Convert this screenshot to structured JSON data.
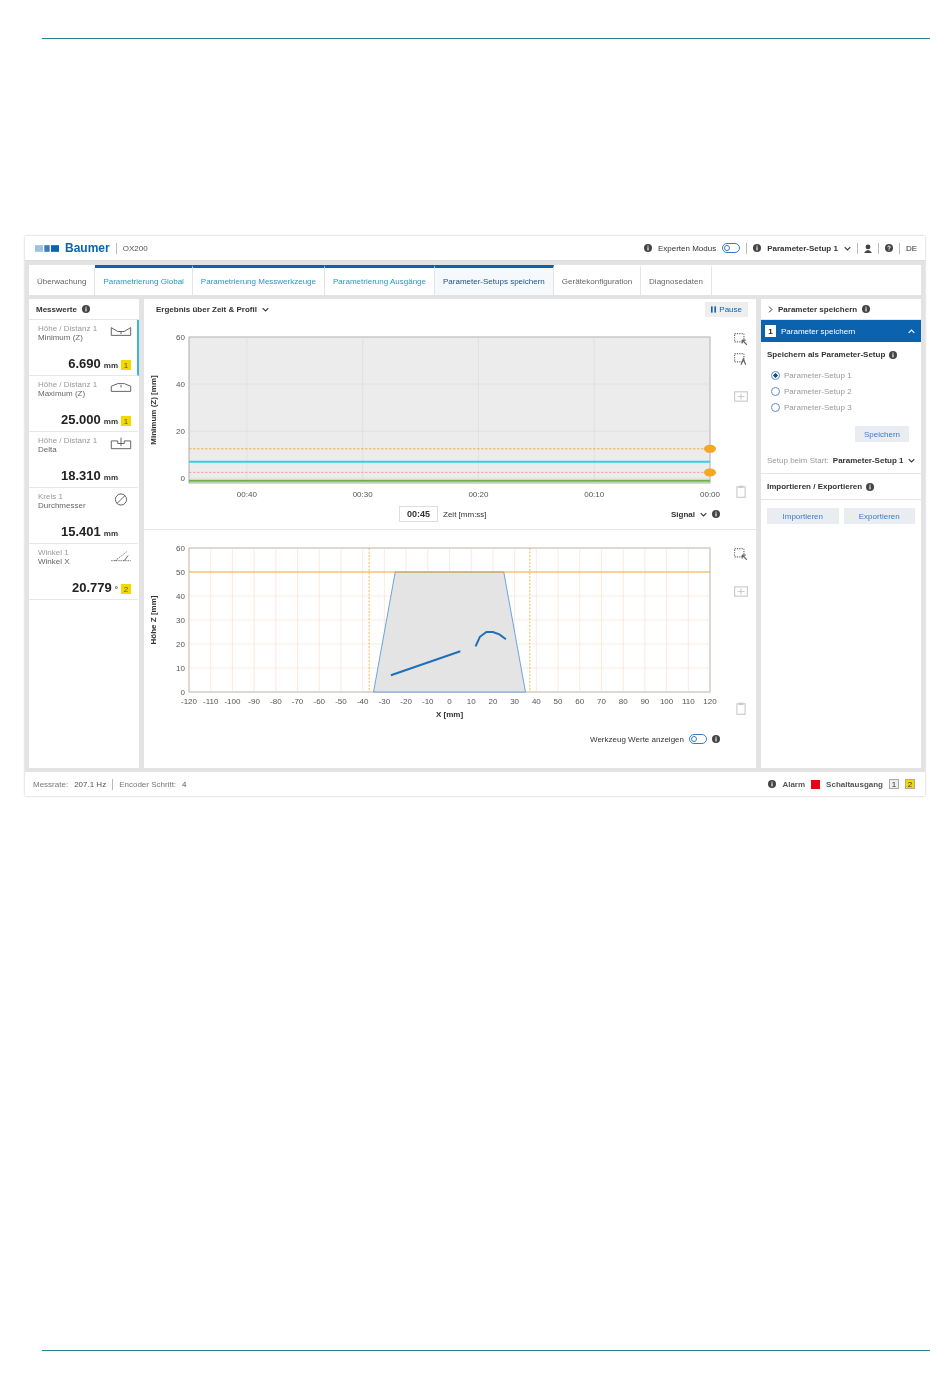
{
  "header": {
    "logo": "Baumer",
    "product": "OX200",
    "expert_label": "Experten Modus",
    "expert_on": false,
    "setup": "Parameter-Setup 1",
    "language": "DE"
  },
  "tabs": [
    {
      "label": "Überwachung",
      "selected": false,
      "grouped": false
    },
    {
      "label": "Parametrierung Global",
      "selected": false,
      "grouped": true
    },
    {
      "label": "Parametrierung Messwerkzeuge",
      "selected": false,
      "grouped": true
    },
    {
      "label": "Parametrierung Ausgänge",
      "selected": false,
      "grouped": true
    },
    {
      "label": "Parameter-Setups speichern",
      "selected": true,
      "grouped": true
    },
    {
      "label": "Gerätekonfiguration",
      "selected": false,
      "grouped": false
    },
    {
      "label": "Diagnosedaten",
      "selected": false,
      "grouped": false
    }
  ],
  "measurements": {
    "title": "Messwerte",
    "items": [
      {
        "category": "Höhe / Distanz 1",
        "name": "Minimum (Z)",
        "value": "6.690",
        "unit": "mm",
        "badge": "1",
        "kind": "min",
        "selected": true
      },
      {
        "category": "Höhe / Distanz 1",
        "name": "Maximum (Z)",
        "value": "25.000",
        "unit": "mm",
        "badge": "1",
        "kind": "max",
        "selected": false
      },
      {
        "category": "Höhe / Distanz 1",
        "name": "Delta",
        "value": "18.310",
        "unit": "mm",
        "kind": "delta",
        "selected": false
      },
      {
        "category": "Kreis 1",
        "name": "Durchmesser",
        "value": "15.401",
        "unit": "mm",
        "kind": "diameter",
        "selected": false
      },
      {
        "category": "Winkel 1",
        "name": "Winkel X",
        "value": "20.779",
        "unit": "°",
        "badge": "2",
        "kind": "angle",
        "selected": false
      }
    ]
  },
  "result": {
    "view": "Ergebnis über Zeit & Profil",
    "pause": "Pause",
    "time_chart": {
      "chart_data": {
        "type": "line",
        "ylabel": "Minimum (Z) [mm]",
        "x": [
          -45,
          0
        ],
        "xlim": [
          -45,
          0
        ],
        "ylim": [
          -2,
          60
        ],
        "grid": true,
        "xticks": [
          {
            "value": -40,
            "label": "00:40"
          },
          {
            "value": -30,
            "label": "00:30"
          },
          {
            "value": -20,
            "label": "00:20"
          },
          {
            "value": -10,
            "label": "00:10"
          },
          {
            "value": 0,
            "label": "00:00"
          }
        ],
        "yticks": [
          0,
          20,
          40,
          60
        ],
        "series": [
          {
            "color": "#3ccbe0",
            "values": [
              7,
              7
            ]
          }
        ],
        "ref_lines": [
          {
            "axis": "y",
            "value": 12.5,
            "color": "#f5a623"
          },
          {
            "axis": "y",
            "value": 2.5,
            "color": "#f29a9a"
          },
          {
            "axis": "y",
            "value": -1,
            "color": "#6cb33f"
          }
        ]
      }
    },
    "time": "00:45",
    "time_label": "Zeit [mm:ss]",
    "signal": "Signal",
    "profile_chart": {
      "chart_data": {
        "type": "line",
        "xlabel": "X [mm]",
        "ylabel": "Höhe Z [mm]",
        "x": [
          -27,
          -11,
          5,
          12,
          14,
          17,
          20,
          23,
          26
        ],
        "xlim": [
          -120,
          120
        ],
        "ylim": [
          0,
          60
        ],
        "grid": true,
        "xticks": [
          -120,
          -110,
          -100,
          -90,
          -80,
          -70,
          -60,
          -50,
          -40,
          -30,
          -20,
          -10,
          0,
          10,
          20,
          30,
          40,
          50,
          60,
          70,
          80,
          90,
          100,
          110,
          120
        ],
        "yticks": [
          0,
          10,
          20,
          30,
          40,
          50,
          60
        ],
        "series": [
          {
            "color": "#1f6fb8",
            "values": [
              7,
              12,
              17,
              null,
              null,
              null,
              null,
              null,
              null
            ]
          },
          {
            "color": "#1f6fb8",
            "values": [
              null,
              null,
              null,
              19,
              23,
              25,
              25,
              24,
              22
            ]
          }
        ],
        "ref_lines": [
          {
            "axis": "x",
            "value": -37,
            "color": "#f5a623"
          },
          {
            "axis": "x",
            "value": 37,
            "color": "#f5a623"
          },
          {
            "axis": "y",
            "value": 50,
            "color": "#f5a623"
          }
        ]
      }
    },
    "tool_label": "Werkzeug Werte anzeigen",
    "tool_on": false
  },
  "panel": {
    "title": "Parameter speichern",
    "step": "1",
    "step_title": "Parameter speichern",
    "save_title": "Speichern als Parameter-Setup",
    "setups": [
      {
        "label": "Parameter-Setup 1",
        "selected": true
      },
      {
        "label": "Parameter-Setup 2",
        "selected": false
      },
      {
        "label": "Parameter-Setup 3",
        "selected": false
      }
    ],
    "save": "Speichern",
    "start_label": "Setup beim Start:",
    "start_value": "Parameter-Setup 1",
    "io_title": "Importieren / Exportieren",
    "import": "Importieren",
    "export": "Exportieren"
  },
  "status_bar": {
    "rate_label": "Messrate:",
    "rate": "207.1 Hz",
    "encoder_label": "Encoder Schritt:",
    "encoder": "4",
    "alarm": "Alarm",
    "alarm_active": true,
    "outputs_label": "Schaltausgang",
    "outputs": [
      {
        "label": "1",
        "on": false
      },
      {
        "label": "2",
        "on": true
      }
    ]
  }
}
